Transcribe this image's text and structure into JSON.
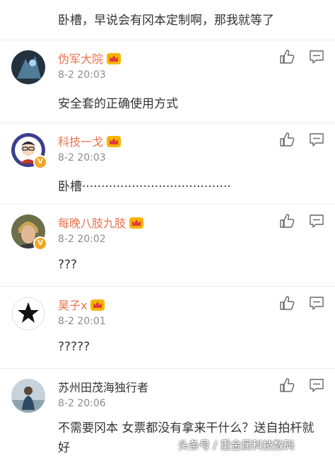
{
  "top_comment": {
    "text": "卧槽，早说会有冈本定制啊，那我就等了"
  },
  "comments": [
    {
      "name": "伪军大院",
      "time": "8-2 20:03",
      "text": "安全套的正确使用方式"
    },
    {
      "name": "科技一戈",
      "time": "8-2 20:03",
      "text": "卧槽·······································",
      "verified": "V"
    },
    {
      "name": "每晚八肢九肢",
      "time": "8-2 20:02",
      "text": "???",
      "verified": "V"
    },
    {
      "name": "昊子x",
      "time": "8-2 20:01",
      "text": "?????"
    },
    {
      "name": "苏州田茂海独行者",
      "time": "8-2 20:06",
      "text": "不需要冈本 女票都没有拿来干什么？送自拍杆就好"
    }
  ],
  "icons": {
    "like": "thumbs-up-icon",
    "reply": "comment-bubble-icon",
    "vip": "crown-icon"
  },
  "colors": {
    "vip_name": "#eb7350",
    "time": "#8c8c8c",
    "badge": "#f5a623"
  },
  "watermark": "头条号 / 重金属科技数码"
}
